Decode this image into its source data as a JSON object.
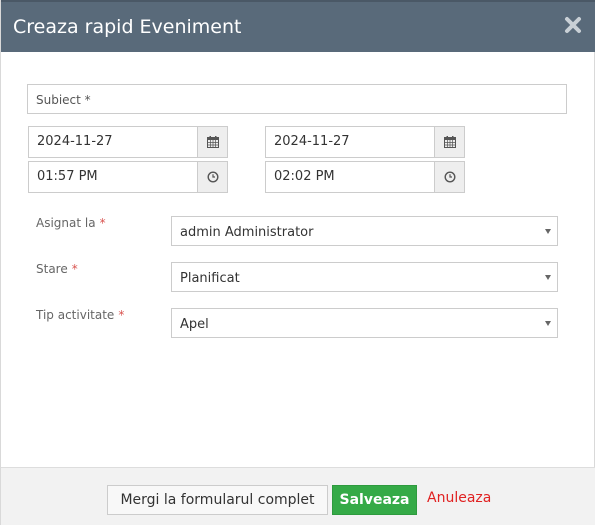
{
  "dialog": {
    "title": "Creaza rapid Eveniment",
    "close_icon": "close-icon"
  },
  "form": {
    "subject": {
      "placeholder": "Subiect *",
      "value": ""
    },
    "start_date": "2024-11-27",
    "end_date": "2024-11-27",
    "start_time": "01:57 PM",
    "end_time": "02:02 PM",
    "date_icon": "calendar-icon",
    "time_icon": "clock-icon",
    "assigned": {
      "label": "Asignat la",
      "required": "*",
      "value": "admin Administrator"
    },
    "status": {
      "label": "Stare",
      "required": "*",
      "value": "Planificat"
    },
    "activity_type": {
      "label": "Tip activitate",
      "required": "*",
      "value": "Apel"
    }
  },
  "footer": {
    "full_form_label": "Mergi la formularul complet",
    "save_label": "Salveaza",
    "cancel_label": "Anuleaza"
  },
  "colors": {
    "header_bg": "#596a7a",
    "save_bg": "#35aa47",
    "cancel_text": "#e02222",
    "required_mark": "#d9534f"
  }
}
